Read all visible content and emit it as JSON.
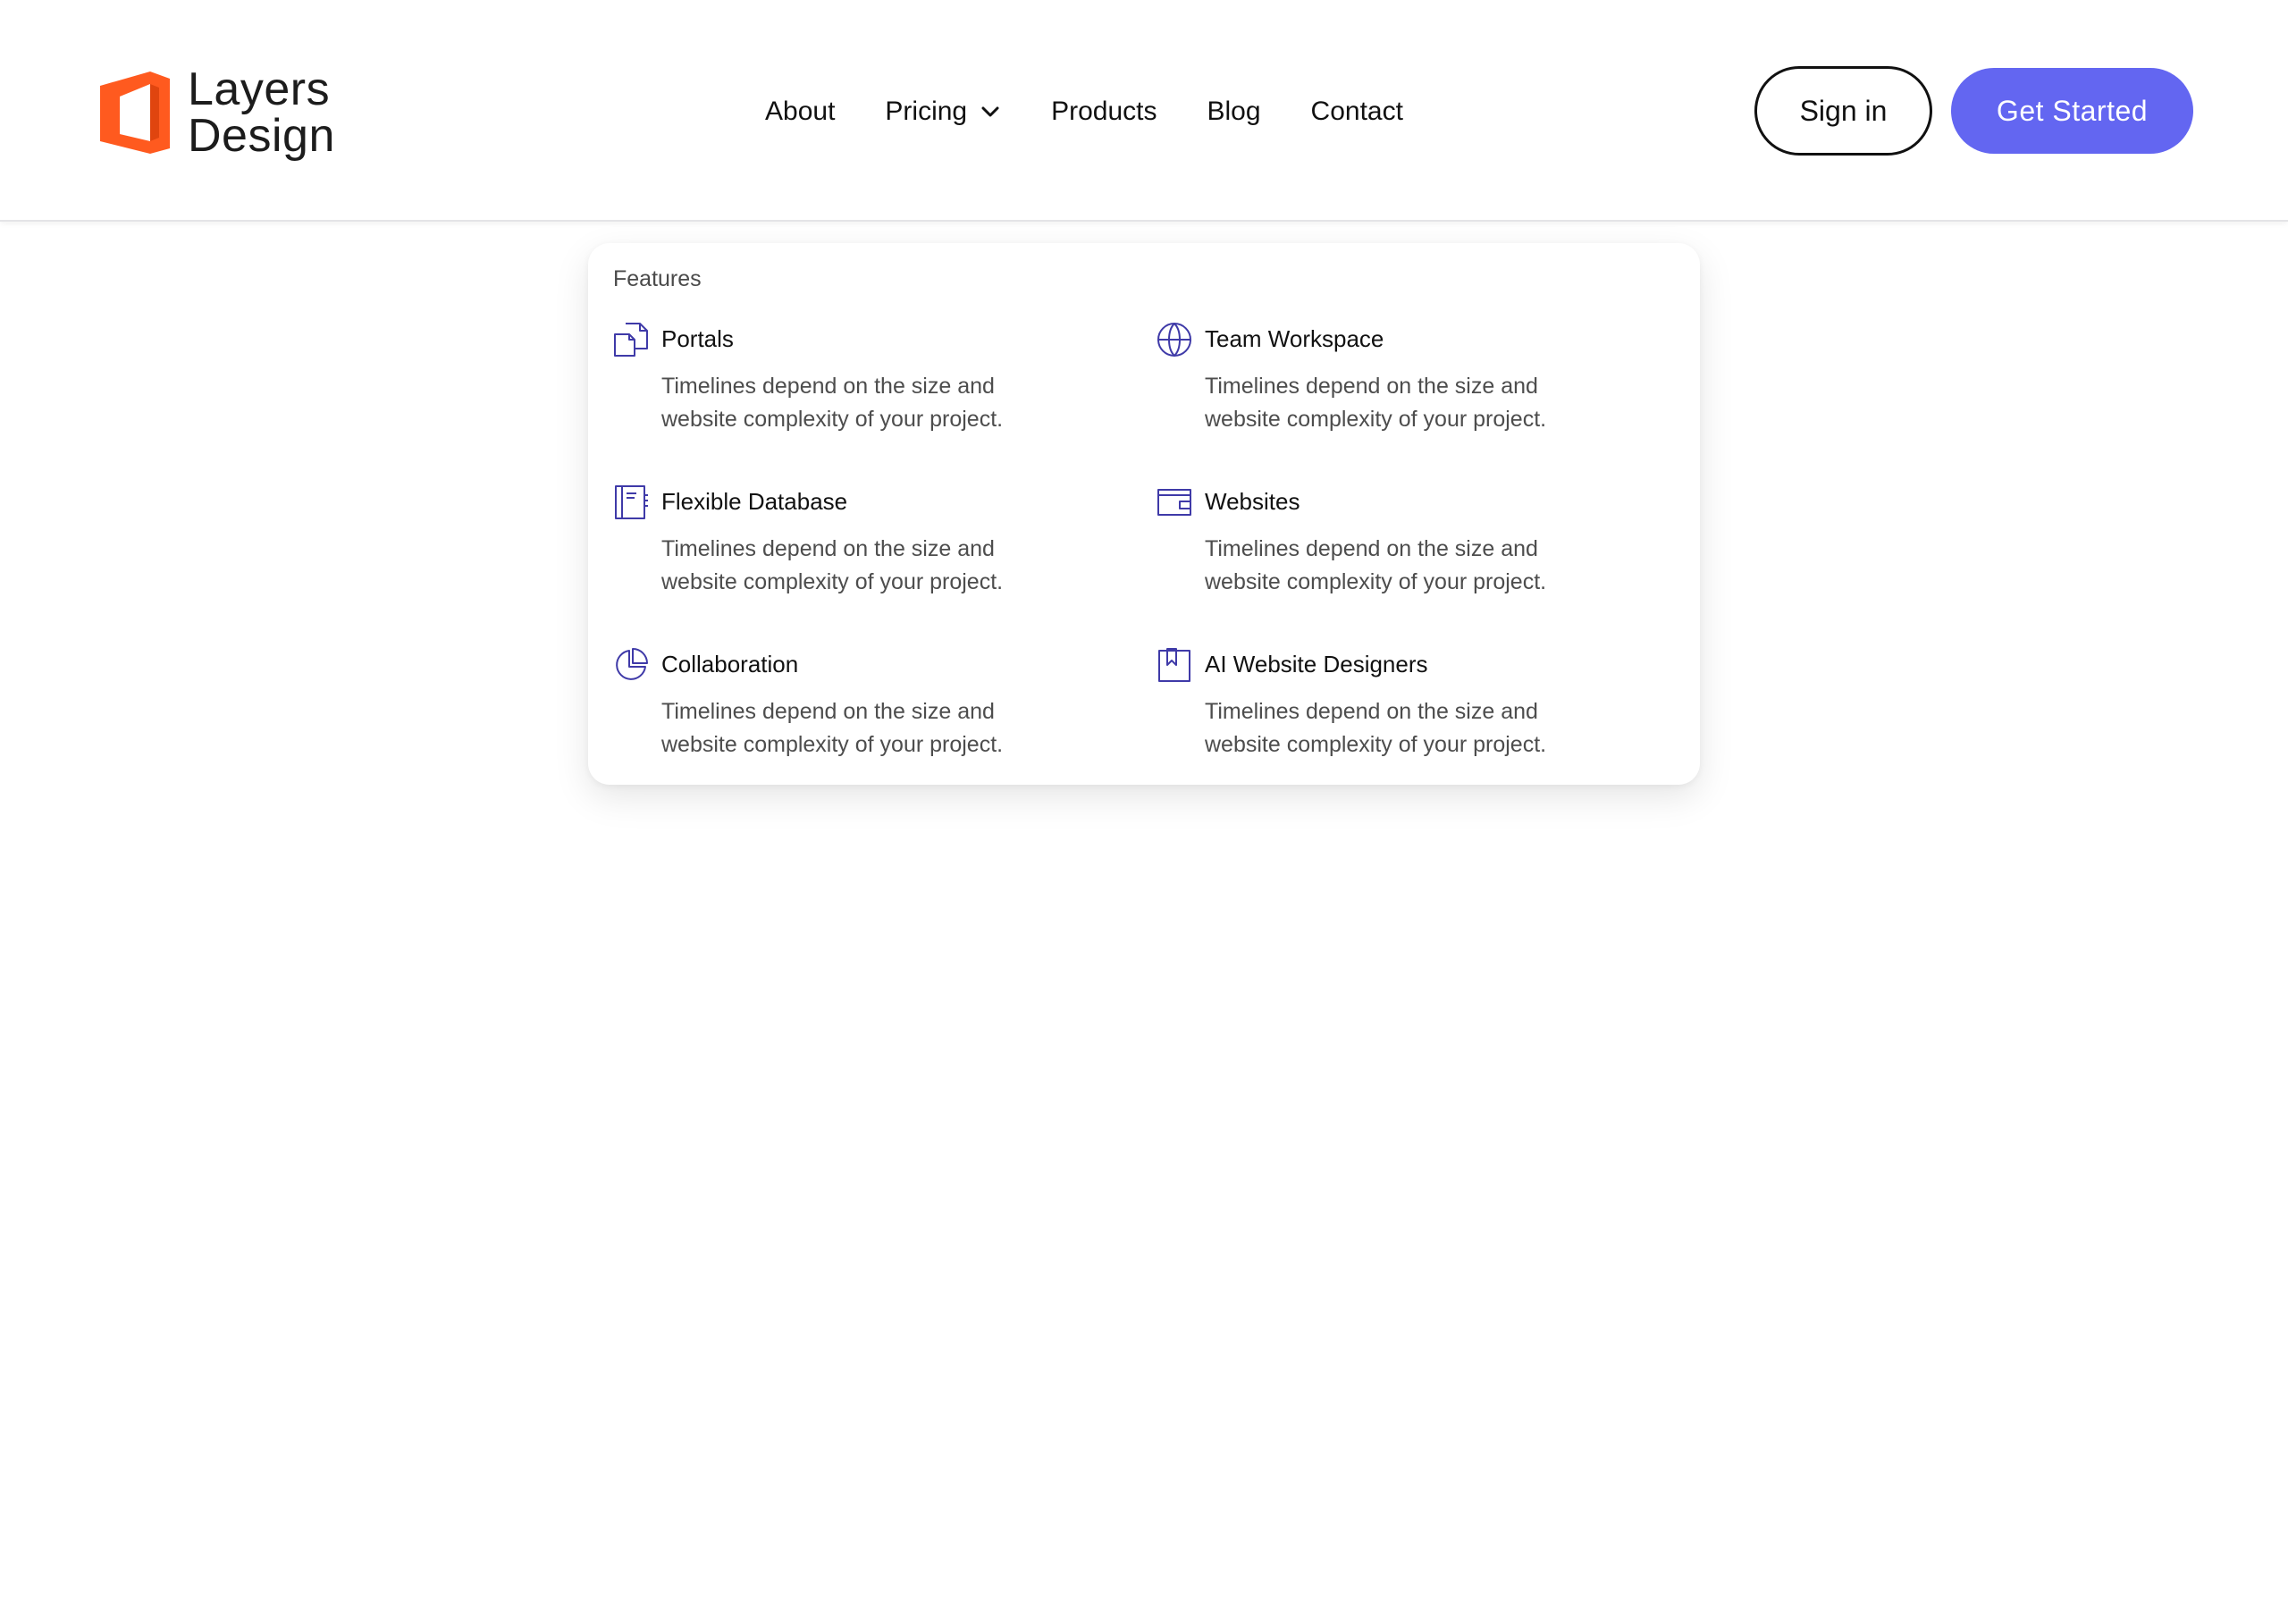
{
  "brand": {
    "line1": "Layers",
    "line2": "Design",
    "logo_color": "#ff5a1f"
  },
  "nav": {
    "items": [
      {
        "label": "About"
      },
      {
        "label": "Pricing",
        "has_dropdown": true
      },
      {
        "label": "Products"
      },
      {
        "label": "Blog"
      },
      {
        "label": "Contact"
      }
    ]
  },
  "actions": {
    "signin_label": "Sign in",
    "get_started_label": "Get Started",
    "accent_color": "#6366f1"
  },
  "dropdown": {
    "heading": "Features",
    "icon_color": "#3f3aa8",
    "features": [
      {
        "title": "Portals",
        "description": "Timelines depend on the size and website complexity of your project.",
        "icon": "documents-icon"
      },
      {
        "title": "Team Workspace",
        "description": "Timelines depend on the size and website complexity of your project.",
        "icon": "globe-icon"
      },
      {
        "title": "Flexible Database",
        "description": "Timelines depend on the size and website complexity of your project.",
        "icon": "notebook-icon"
      },
      {
        "title": "Websites",
        "description": "Timelines depend on the size and website complexity of your project.",
        "icon": "wallet-icon"
      },
      {
        "title": "Collaboration",
        "description": "Timelines depend on the size and website complexity of your project.",
        "icon": "pie-chart-icon"
      },
      {
        "title": "AI Website Designers",
        "description": "Timelines depend on the size and website complexity of your project.",
        "icon": "bookmark-icon"
      }
    ]
  }
}
